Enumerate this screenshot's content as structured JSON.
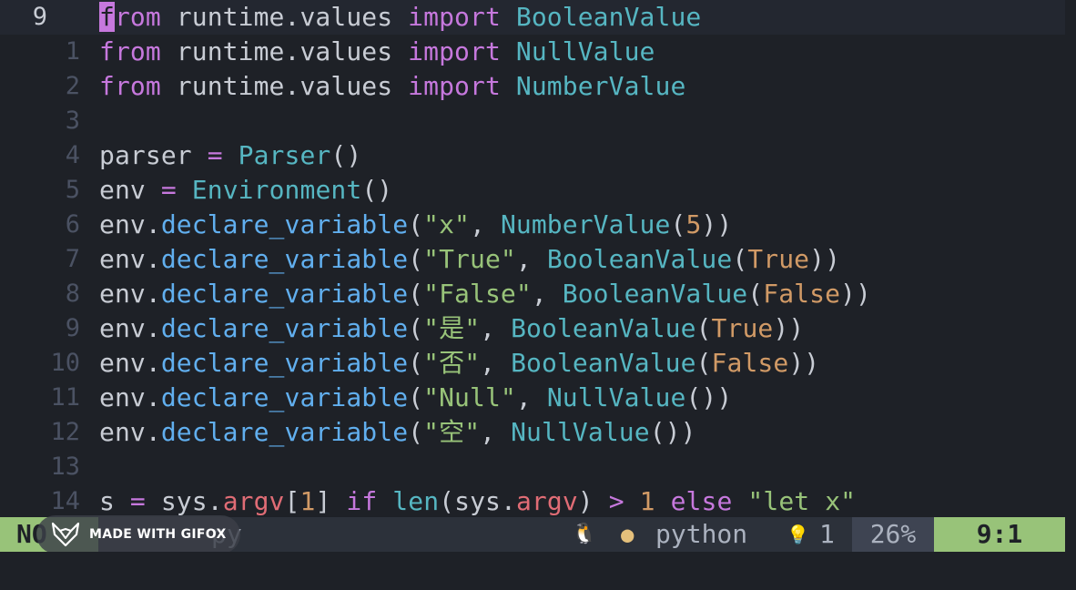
{
  "editor": {
    "lines": [
      {
        "num": "9",
        "current": true,
        "tokens": [
          {
            "t": "f",
            "c": "cursor"
          },
          {
            "t": "rom",
            "c": "t-kw"
          },
          {
            "t": " runtime.values ",
            "c": "t-plain"
          },
          {
            "t": "import",
            "c": "t-kw"
          },
          {
            "t": " ",
            "c": "t-plain"
          },
          {
            "t": "BooleanValue",
            "c": "t-class"
          }
        ]
      },
      {
        "num": "1",
        "tokens": [
          {
            "t": "from",
            "c": "t-kw"
          },
          {
            "t": " runtime.values ",
            "c": "t-plain"
          },
          {
            "t": "import",
            "c": "t-kw"
          },
          {
            "t": " ",
            "c": "t-plain"
          },
          {
            "t": "NullValue",
            "c": "t-class"
          }
        ]
      },
      {
        "num": "2",
        "tokens": [
          {
            "t": "from",
            "c": "t-kw"
          },
          {
            "t": " runtime.values ",
            "c": "t-plain"
          },
          {
            "t": "import",
            "c": "t-kw"
          },
          {
            "t": " ",
            "c": "t-plain"
          },
          {
            "t": "NumberValue",
            "c": "t-class"
          }
        ]
      },
      {
        "num": "3",
        "tokens": []
      },
      {
        "num": "4",
        "tokens": [
          {
            "t": "parser ",
            "c": "t-plain"
          },
          {
            "t": "=",
            "c": "t-op"
          },
          {
            "t": " ",
            "c": "t-plain"
          },
          {
            "t": "Parser",
            "c": "t-class"
          },
          {
            "t": "()",
            "c": "t-plain"
          }
        ]
      },
      {
        "num": "5",
        "tokens": [
          {
            "t": "env ",
            "c": "t-plain"
          },
          {
            "t": "=",
            "c": "t-op"
          },
          {
            "t": " ",
            "c": "t-plain"
          },
          {
            "t": "Environment",
            "c": "t-class"
          },
          {
            "t": "()",
            "c": "t-plain"
          }
        ]
      },
      {
        "num": "6",
        "tokens": [
          {
            "t": "env.",
            "c": "t-plain"
          },
          {
            "t": "declare_variable",
            "c": "t-fn"
          },
          {
            "t": "(",
            "c": "t-plain"
          },
          {
            "t": "\"x\"",
            "c": "t-str"
          },
          {
            "t": ", ",
            "c": "t-plain"
          },
          {
            "t": "NumberValue",
            "c": "t-class"
          },
          {
            "t": "(",
            "c": "t-plain"
          },
          {
            "t": "5",
            "c": "t-num"
          },
          {
            "t": "))",
            "c": "t-plain"
          }
        ]
      },
      {
        "num": "7",
        "tokens": [
          {
            "t": "env.",
            "c": "t-plain"
          },
          {
            "t": "declare_variable",
            "c": "t-fn"
          },
          {
            "t": "(",
            "c": "t-plain"
          },
          {
            "t": "\"True\"",
            "c": "t-str"
          },
          {
            "t": ", ",
            "c": "t-plain"
          },
          {
            "t": "BooleanValue",
            "c": "t-class"
          },
          {
            "t": "(",
            "c": "t-plain"
          },
          {
            "t": "True",
            "c": "t-bool"
          },
          {
            "t": "))",
            "c": "t-plain"
          }
        ]
      },
      {
        "num": "8",
        "tokens": [
          {
            "t": "env.",
            "c": "t-plain"
          },
          {
            "t": "declare_variable",
            "c": "t-fn"
          },
          {
            "t": "(",
            "c": "t-plain"
          },
          {
            "t": "\"False\"",
            "c": "t-str"
          },
          {
            "t": ", ",
            "c": "t-plain"
          },
          {
            "t": "BooleanValue",
            "c": "t-class"
          },
          {
            "t": "(",
            "c": "t-plain"
          },
          {
            "t": "False",
            "c": "t-bool"
          },
          {
            "t": "))",
            "c": "t-plain"
          }
        ]
      },
      {
        "num": "9",
        "tokens": [
          {
            "t": "env.",
            "c": "t-plain"
          },
          {
            "t": "declare_variable",
            "c": "t-fn"
          },
          {
            "t": "(",
            "c": "t-plain"
          },
          {
            "t": "\"是\"",
            "c": "t-str"
          },
          {
            "t": ", ",
            "c": "t-plain"
          },
          {
            "t": "BooleanValue",
            "c": "t-class"
          },
          {
            "t": "(",
            "c": "t-plain"
          },
          {
            "t": "True",
            "c": "t-bool"
          },
          {
            "t": "))",
            "c": "t-plain"
          }
        ]
      },
      {
        "num": "10",
        "tokens": [
          {
            "t": "env.",
            "c": "t-plain"
          },
          {
            "t": "declare_variable",
            "c": "t-fn"
          },
          {
            "t": "(",
            "c": "t-plain"
          },
          {
            "t": "\"否\"",
            "c": "t-str"
          },
          {
            "t": ", ",
            "c": "t-plain"
          },
          {
            "t": "BooleanValue",
            "c": "t-class"
          },
          {
            "t": "(",
            "c": "t-plain"
          },
          {
            "t": "False",
            "c": "t-bool"
          },
          {
            "t": "))",
            "c": "t-plain"
          }
        ]
      },
      {
        "num": "11",
        "tokens": [
          {
            "t": "env.",
            "c": "t-plain"
          },
          {
            "t": "declare_variable",
            "c": "t-fn"
          },
          {
            "t": "(",
            "c": "t-plain"
          },
          {
            "t": "\"Null\"",
            "c": "t-str"
          },
          {
            "t": ", ",
            "c": "t-plain"
          },
          {
            "t": "NullValue",
            "c": "t-class"
          },
          {
            "t": "())",
            "c": "t-plain"
          }
        ]
      },
      {
        "num": "12",
        "tokens": [
          {
            "t": "env.",
            "c": "t-plain"
          },
          {
            "t": "declare_variable",
            "c": "t-fn"
          },
          {
            "t": "(",
            "c": "t-plain"
          },
          {
            "t": "\"空\"",
            "c": "t-str"
          },
          {
            "t": ", ",
            "c": "t-plain"
          },
          {
            "t": "NullValue",
            "c": "t-class"
          },
          {
            "t": "())",
            "c": "t-plain"
          }
        ]
      },
      {
        "num": "13",
        "tokens": []
      },
      {
        "num": "14",
        "tokens": [
          {
            "t": "s ",
            "c": "t-plain"
          },
          {
            "t": "=",
            "c": "t-op"
          },
          {
            "t": " sys.",
            "c": "t-plain"
          },
          {
            "t": "argv",
            "c": "t-attr"
          },
          {
            "t": "[",
            "c": "t-plain"
          },
          {
            "t": "1",
            "c": "t-num"
          },
          {
            "t": "] ",
            "c": "t-plain"
          },
          {
            "t": "if",
            "c": "t-kw"
          },
          {
            "t": " ",
            "c": "t-plain"
          },
          {
            "t": "len",
            "c": "t-builtin"
          },
          {
            "t": "(sys.",
            "c": "t-plain"
          },
          {
            "t": "argv",
            "c": "t-attr"
          },
          {
            "t": ") ",
            "c": "t-plain"
          },
          {
            "t": ">",
            "c": "t-op"
          },
          {
            "t": " ",
            "c": "t-plain"
          },
          {
            "t": "1",
            "c": "t-num"
          },
          {
            "t": " ",
            "c": "t-plain"
          },
          {
            "t": "else",
            "c": "t-kw"
          },
          {
            "t": " ",
            "c": "t-plain"
          },
          {
            "t": "\"let x\"",
            "c": "t-str"
          }
        ]
      }
    ]
  },
  "statusline": {
    "mode": "NO",
    "filename": "py",
    "os_icon": "linux-tux-icon",
    "os_glyph": "🐧",
    "filetype_icon": "python-icon",
    "filetype_glyph": "●",
    "filetype": "python",
    "diagnostic_icon": "lightbulb-icon",
    "diagnostic_glyph": "💡",
    "diagnostic_count": "1",
    "percent": "26%",
    "position": "9:1"
  },
  "overlay": {
    "logo_icon": "gifox-fox-icon",
    "text": "MADE WITH GIFOX"
  },
  "colors": {
    "background": "#1e2127",
    "keyword": "#c678dd",
    "class": "#56b6c2",
    "function": "#61afef",
    "string": "#98c379",
    "number": "#d19a66",
    "mode_bg": "#98c379"
  }
}
